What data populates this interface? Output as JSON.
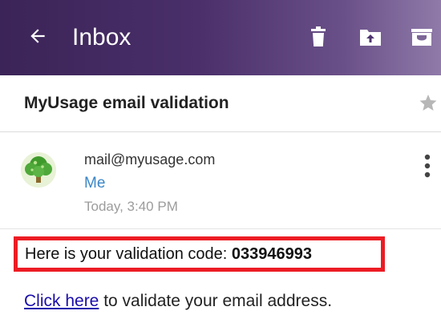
{
  "header": {
    "title": "Inbox",
    "back_icon": "arrow-left-icon",
    "actions": [
      {
        "name": "delete",
        "icon": "trash-icon"
      },
      {
        "name": "move",
        "icon": "folder-move-icon"
      },
      {
        "name": "archive",
        "icon": "archive-icon"
      }
    ],
    "gradient_start": "#3b2457",
    "gradient_end": "#8f7aa9"
  },
  "message": {
    "subject": "MyUsage email validation",
    "starred": false,
    "sender_email": "mail@myusage.com",
    "recipient": "Me",
    "date": "Today, 3:40 PM",
    "avatar_icon": "tree-icon"
  },
  "body": {
    "code_prefix": "Here is your validation code: ",
    "code": "033946993",
    "link_text": "Click here",
    "link_suffix": " to validate your email address.",
    "highlight_color": "#ec1c24",
    "link_color": "#1a0dab"
  }
}
